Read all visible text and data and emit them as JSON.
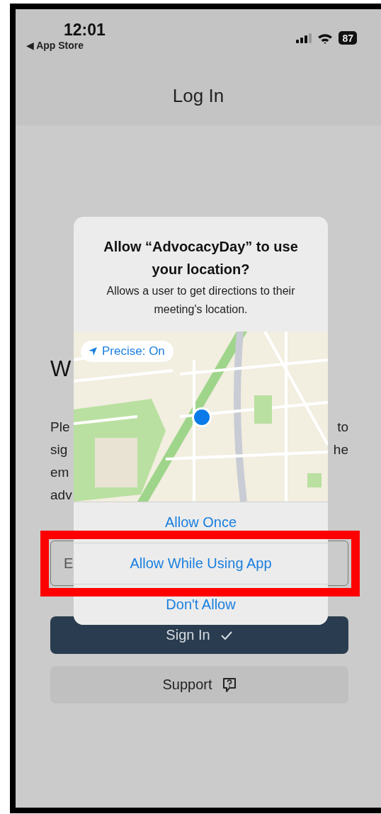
{
  "status_bar": {
    "time": "12:01",
    "back_link": "◀ App Store",
    "battery": "87"
  },
  "nav": {
    "title": "Log In"
  },
  "page": {
    "heading": "W",
    "intro_lines": [
      {
        "left": "Ple",
        "right": "to"
      },
      {
        "left": "sig",
        "right": "he"
      },
      {
        "left": "em"
      },
      {
        "left": "adv"
      }
    ],
    "email_field": {
      "placeholder": "E"
    },
    "buttons": [
      {
        "kind": "primary",
        "label": "Sign In"
      },
      {
        "kind": "secondary",
        "label": "Support"
      }
    ]
  },
  "alert": {
    "title": "Allow “AdvocacyDay” to use your location?",
    "message": "Allows a user to get directions to their meeting's location.",
    "precise_toggle": {
      "label": "Precise: On",
      "on": true
    },
    "actions": [
      {
        "label": "Allow Once"
      },
      {
        "label": "Allow While Using App"
      },
      {
        "label": "Don't Allow"
      }
    ]
  }
}
